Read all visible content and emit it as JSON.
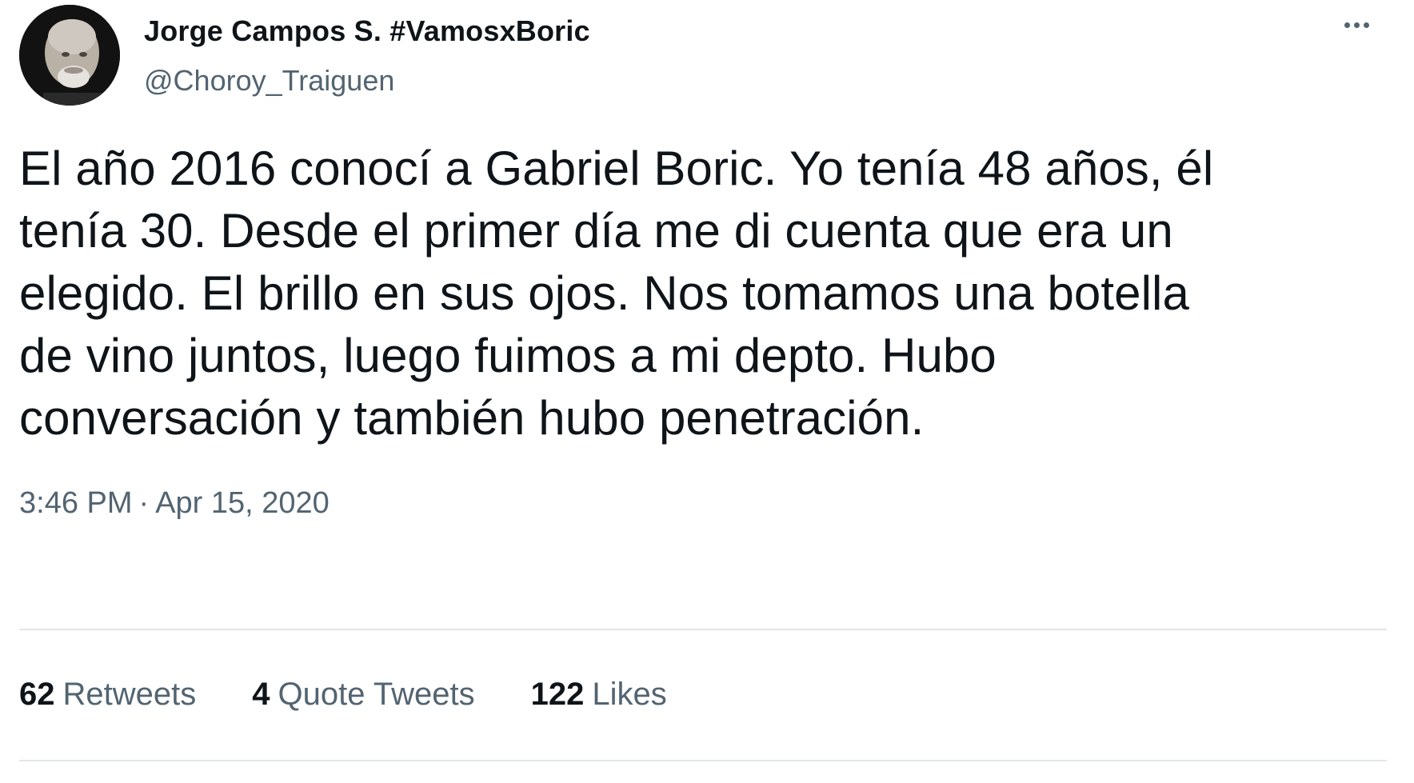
{
  "author": {
    "display_name": "Jorge Campos S. #VamosxBoric",
    "handle": "@Choroy_Traiguen"
  },
  "tweet": {
    "text": "El año 2016 conocí a Gabriel Boric. Yo tenía 48 años, él\ntenía 30. Desde el primer día me di cuenta que era un\nelegido. El brillo en sus ojos. Nos tomamos una botella\nde vino juntos, luego fuimos a mi depto. Hubo\nconversación y también hubo penetración.",
    "time": "3:46 PM",
    "separator": "·",
    "date": "Apr 15, 2020"
  },
  "stats": {
    "retweets": {
      "count": "62",
      "label": "Retweets"
    },
    "quote_tweets": {
      "count": "4",
      "label": "Quote Tweets"
    },
    "likes": {
      "count": "122",
      "label": "Likes"
    }
  },
  "icons": {
    "more": "more-horizontal-icon",
    "avatar": "profile-avatar"
  },
  "colors": {
    "primary_text": "#0f1419",
    "secondary_text": "#536471",
    "divider": "#e1e6ea",
    "background": "#ffffff"
  }
}
